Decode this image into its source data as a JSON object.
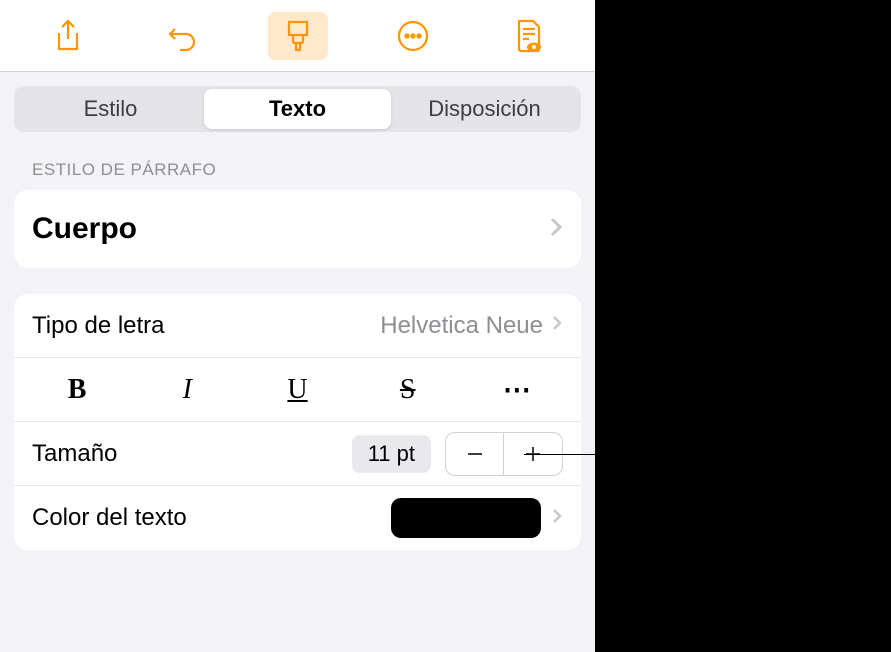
{
  "toolbar": {
    "share_icon": "share-icon",
    "undo_icon": "undo-icon",
    "brush_icon": "brush-icon",
    "more_icon": "more-circle-icon",
    "doc_icon": "document-view-icon"
  },
  "tabs": {
    "style": "Estilo",
    "text": "Texto",
    "layout": "Disposición"
  },
  "section_header": "ESTILO DE PÁRRAFO",
  "paragraph_style": "Cuerpo",
  "font_row": {
    "label": "Tipo de letra",
    "value": "Helvetica Neue"
  },
  "format": {
    "bold": "B",
    "italic": "I",
    "underline": "U",
    "strike": "S",
    "more": "⋯"
  },
  "size_row": {
    "label": "Tamaño",
    "value": "11 pt"
  },
  "color_row": {
    "label": "Color del texto",
    "swatch": "#000000"
  }
}
